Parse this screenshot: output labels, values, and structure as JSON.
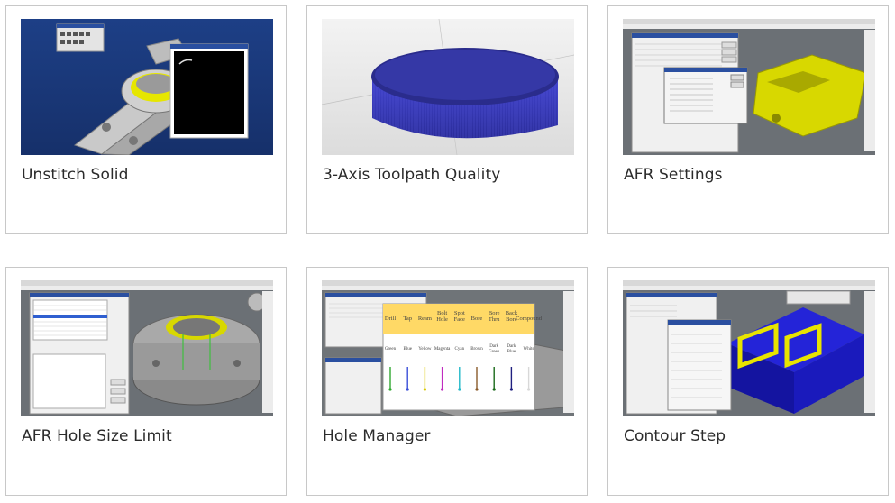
{
  "cards": [
    {
      "title": "Unstitch Solid"
    },
    {
      "title": "3-Axis Toolpath Quality"
    },
    {
      "title": "AFR Settings"
    },
    {
      "title": "AFR Hole Size Limit"
    },
    {
      "title": "Hole Manager"
    },
    {
      "title": "Contour Step"
    }
  ],
  "hole_manager_table": {
    "headers": [
      "Drill",
      "Tap",
      "Ream",
      "Bolt Hole",
      "Spot Face",
      "Bore",
      "Bore Thru",
      "Back Bore",
      "Compound"
    ],
    "colors": [
      "Green",
      "Blue",
      "Yellow",
      "Magenta",
      "Cyan",
      "Brown",
      "Dark Green",
      "Dark Blue",
      "White"
    ]
  },
  "colors": {
    "card_border": "#c8c8c8",
    "title_text": "#2b2b2b",
    "cad_background": "#1f3f7a",
    "cad_gray_background": "#6f7478",
    "toolpath_blue": "#3d3fbf",
    "highlight_yellow": "#e8e400",
    "table_header": "#ffd966"
  }
}
